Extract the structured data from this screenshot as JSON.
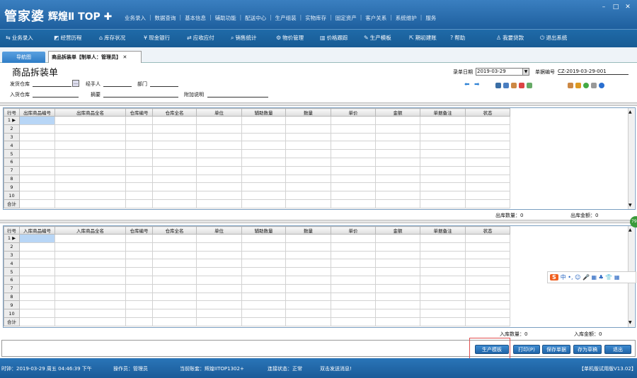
{
  "app": {
    "logo_main": "管家婆",
    "logo_sub": "辉煌Ⅱ TOP ✚",
    "window_min": "–",
    "window_max": "□",
    "window_close": "✕"
  },
  "main_nav": [
    "业务录入",
    "数据查询",
    "基本信息",
    "辅助功能",
    "配送中心",
    "生产组装",
    "实物库存",
    "固定资产",
    "客户关系",
    "系统维护",
    "服务"
  ],
  "toolbar": [
    {
      "label": "业务录入",
      "icon": "ledger-icon"
    },
    {
      "label": "经营历程",
      "icon": "chart-icon"
    },
    {
      "label": "库存状况",
      "icon": "warehouse-icon"
    },
    {
      "label": "现金银行",
      "icon": "yen-icon"
    },
    {
      "label": "应收应付",
      "icon": "transfer-icon"
    },
    {
      "label": "销售统计",
      "icon": "magnifier-icon"
    },
    {
      "label": "物价管理",
      "icon": "gear-icon"
    },
    {
      "label": "价格跟踪",
      "icon": "bar-icon"
    },
    {
      "label": "生产模板",
      "icon": "wrench-icon"
    },
    {
      "label": "期初建账",
      "icon": "export-icon"
    },
    {
      "label": "帮助",
      "icon": "help-icon"
    },
    {
      "label": "我要贷款",
      "icon": "bank-icon"
    },
    {
      "label": "退出系统",
      "icon": "power-icon"
    }
  ],
  "tabs": {
    "nav": "导航图",
    "doc": "商品拆装单【制单人：管理员】",
    "doc_close": "✕"
  },
  "form": {
    "title": "商品拆装单",
    "out_warehouse": "发货仓库",
    "handler": "经手人",
    "department": "部门",
    "in_warehouse": "入货仓库",
    "summary": "摘要",
    "note": "附加说明",
    "date_label": "录单日期",
    "date_value": "2019-03-29",
    "docno_label": "单据编号",
    "docno_value": "CZ-2019-03-29-001"
  },
  "grid_out": {
    "headers": [
      "行号",
      "出库商品编号",
      "出库商品全名",
      "仓库编号",
      "仓库全名",
      "单位",
      "辅助数量",
      "数量",
      "单价",
      "金额",
      "单据备注",
      "状态"
    ],
    "rows": [
      "1",
      "2",
      "3",
      "4",
      "5",
      "6",
      "7",
      "8",
      "9",
      "10"
    ],
    "total": "合计",
    "qty_label": "出库数量：0",
    "amount_label": "出库金额：0"
  },
  "grid_in": {
    "headers": [
      "行号",
      "入库商品编号",
      "入库商品全名",
      "仓库编号",
      "仓库全名",
      "单位",
      "辅助数量",
      "数量",
      "单价",
      "金额",
      "单据备注",
      "状态"
    ],
    "rows": [
      "1",
      "2",
      "3",
      "4",
      "5",
      "6",
      "7",
      "8",
      "9",
      "10"
    ],
    "total": "合计",
    "qty_label": "入库数量：0",
    "amount_label": "入库金额：0"
  },
  "ime": {
    "s": "S",
    "text": "中 •, ☺ 🎤 ▦ ♣ 👕 ▦"
  },
  "side_badge": "79",
  "buttons": {
    "produce_template": "生产模板",
    "print": "打印(P)",
    "save": "保存单据",
    "draft": "存为草稿",
    "exit": "退出"
  },
  "status": {
    "time": "时钟：2019-03-29 周五 04:46:39 下午",
    "operator": "操作员：管理员",
    "account": "当前账套：辉煌IITOP1302+",
    "conn": "连接状态：正常",
    "msg": "双击发送消息!",
    "version": "【单机版试用版V13.02】"
  }
}
